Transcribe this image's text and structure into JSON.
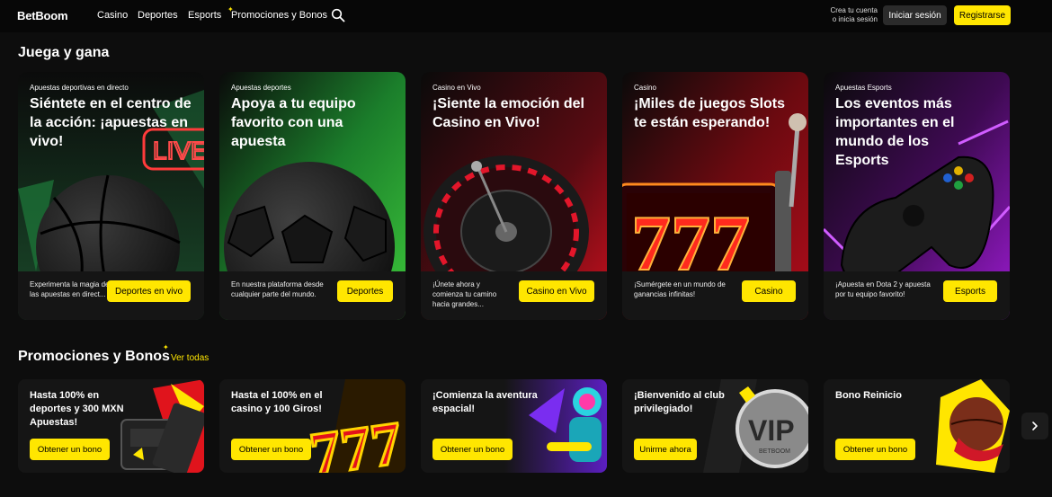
{
  "header": {
    "logo": "BetBoom",
    "nav": {
      "casino": "Casino",
      "deportes": "Deportes",
      "esports": "Esports",
      "promos": "Promociones y Bonos",
      "promos_star": "✦"
    },
    "crea_line1": "Crea tu cuenta",
    "crea_line2": "o inicia sesión",
    "login": "Iniciar sesión",
    "register": "Registrarse"
  },
  "sections": {
    "juega": "Juega y gana",
    "promos": "Promociones y Bonos",
    "promos_star": "✦",
    "ver_todas": "Ver todas"
  },
  "cards": [
    {
      "category": "Apuestas deportivas en directo",
      "title": "Siéntete en el centro de la acción: ¡apuestas en vivo!",
      "desc": "Experimenta la magia de las apuestas en direct...",
      "cta": "Deportes en vivo",
      "icon": "basketball-icon",
      "badge": "LIVE"
    },
    {
      "category": "Apuestas deportes",
      "title": "Apoya a tu equipo favorito con una apuesta",
      "desc": "En nuestra plataforma desde cualquier parte del mundo.",
      "cta": "Deportes",
      "icon": "soccer-ball-icon"
    },
    {
      "category": "Casino en Vivo",
      "title": "¡Siente la emoción del Casino en Vivo!",
      "desc": "¡Únete ahora y comienza tu camino hacia grandes...",
      "cta": "Casino en Vivo",
      "icon": "roulette-icon"
    },
    {
      "category": "Casino",
      "title": "¡Miles de juegos Slots te están esperando!",
      "desc": "¡Sumérgete en un mundo de ganancias infinitas!",
      "cta": "Casino",
      "icon": "slot-machine-icon",
      "slot_text": "777"
    },
    {
      "category": "Apuestas Esports",
      "title": "Los eventos más importantes en el mundo de los Esports",
      "desc": "¡Apuesta en Dota 2 y apuesta por tu equipo favorito!",
      "cta": "Esports",
      "icon": "gamepad-icon"
    }
  ],
  "promos": [
    {
      "title": "Hasta 100% en deportes y 300 MXN Apuestas!",
      "cta": "Obtener un bono",
      "icon": "payment-terminal-icon"
    },
    {
      "title": "Hasta el 100% en el casino y 100 Giros!",
      "cta": "Obtener un bono",
      "icon": "slot-777-icon",
      "art_text": "777"
    },
    {
      "title": "¡Comienza la aventura espacial!",
      "cta": "Obtener un bono",
      "icon": "astronaut-icon"
    },
    {
      "title": "¡Bienvenido al club privilegiado!",
      "cta": "Unirme ahora",
      "icon": "vip-badge-icon",
      "art_text": "VIP",
      "art_sub": "BETBOOM"
    },
    {
      "title": "Bono Reinicio",
      "cta": "Obtener un bono",
      "icon": "basketball-monster-icon"
    }
  ],
  "colors": {
    "accent": "#ffe600",
    "background": "#0d0d0d"
  }
}
